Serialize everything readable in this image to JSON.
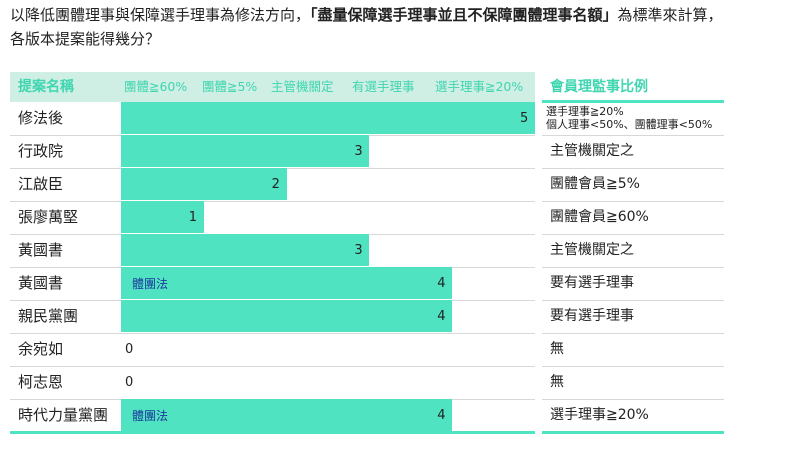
{
  "title": {
    "part1": "以降低團體理事與保障選手理事為修法方向，",
    "emph": "「盡量保障選手理事並且不保障團體理事名額」",
    "part2": "為標準來計算，",
    "line2": "各版本提案能得幾分？"
  },
  "headers": {
    "proposal": "提案名稱",
    "ratio": "會員理監事比例",
    "levels": [
      "團體≧60%",
      "團體≧5%",
      "主管機關定",
      "有選手理事",
      "選手理事≧20%"
    ]
  },
  "colors": {
    "bar": "#4fe3c1",
    "header_text": "#3fd6b0",
    "header_band": "#cfeee4",
    "note": "#1d3a9e"
  },
  "chart_data": {
    "type": "bar",
    "orientation": "horizontal",
    "xlim": [
      0,
      5
    ],
    "categories": [
      "修法後",
      "行政院",
      "江啟臣",
      "張廖萬堅",
      "黃國書",
      "黃國書",
      "親民黨團",
      "余宛如",
      "柯志恩",
      "時代力量黨團"
    ],
    "values": [
      5,
      3,
      2,
      1,
      3,
      4,
      4,
      0,
      0,
      4
    ],
    "notes": [
      "",
      "",
      "",
      "",
      "",
      "體團法",
      "",
      "",
      "",
      "體團法"
    ],
    "ratios": [
      [
        "選手理事≧20%",
        "個人理事<50%、團體理事<50%"
      ],
      [
        "主管機關定之"
      ],
      [
        "團體會員≧5%"
      ],
      [
        "團體會員≧60%"
      ],
      [
        "主管機關定之"
      ],
      [
        "要有選手理事"
      ],
      [
        "要有選手理事"
      ],
      [
        "無"
      ],
      [
        "無"
      ],
      [
        "選手理事≧20%"
      ]
    ]
  }
}
